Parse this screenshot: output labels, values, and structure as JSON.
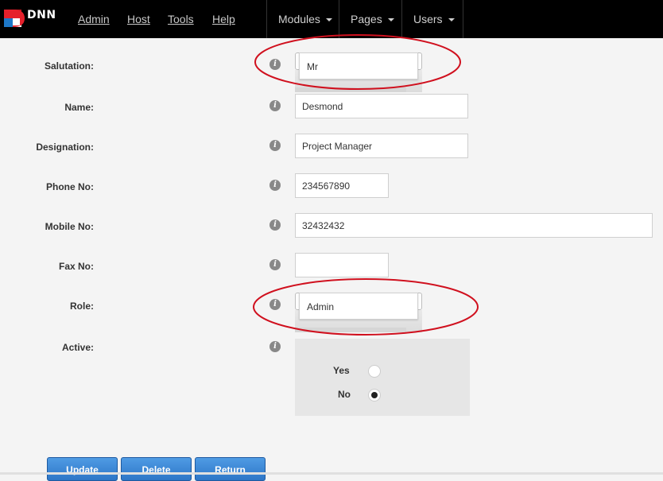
{
  "header": {
    "brand": "DNN",
    "links": [
      "Admin",
      "Host",
      "Tools",
      "Help"
    ],
    "menus": [
      "Modules",
      "Pages",
      "Users"
    ]
  },
  "form": {
    "salutation": {
      "label": "Salutation:",
      "value": "Mr"
    },
    "name": {
      "label": "Name:",
      "value": "Desmond"
    },
    "designation": {
      "label": "Designation:",
      "value": "Project Manager"
    },
    "phone": {
      "label": "Phone No:",
      "value": "234567890"
    },
    "mobile": {
      "label": "Mobile No:",
      "value": "32432432"
    },
    "fax": {
      "label": "Fax No:",
      "value": ""
    },
    "role": {
      "label": "Role:",
      "value": "Admin"
    },
    "active": {
      "label": "Active:",
      "options": [
        {
          "label": "Yes",
          "checked": false
        },
        {
          "label": "No",
          "checked": true
        }
      ]
    }
  },
  "buttons": {
    "update": "Update",
    "delete": "Delete",
    "return": "Return"
  },
  "colors": {
    "topbar": "#000000",
    "button": "#3a86d4",
    "annotation": "#d0101e",
    "logo_red": "#e5202b",
    "logo_blue": "#1e78c8"
  },
  "icons": {
    "info": "info-icon"
  }
}
